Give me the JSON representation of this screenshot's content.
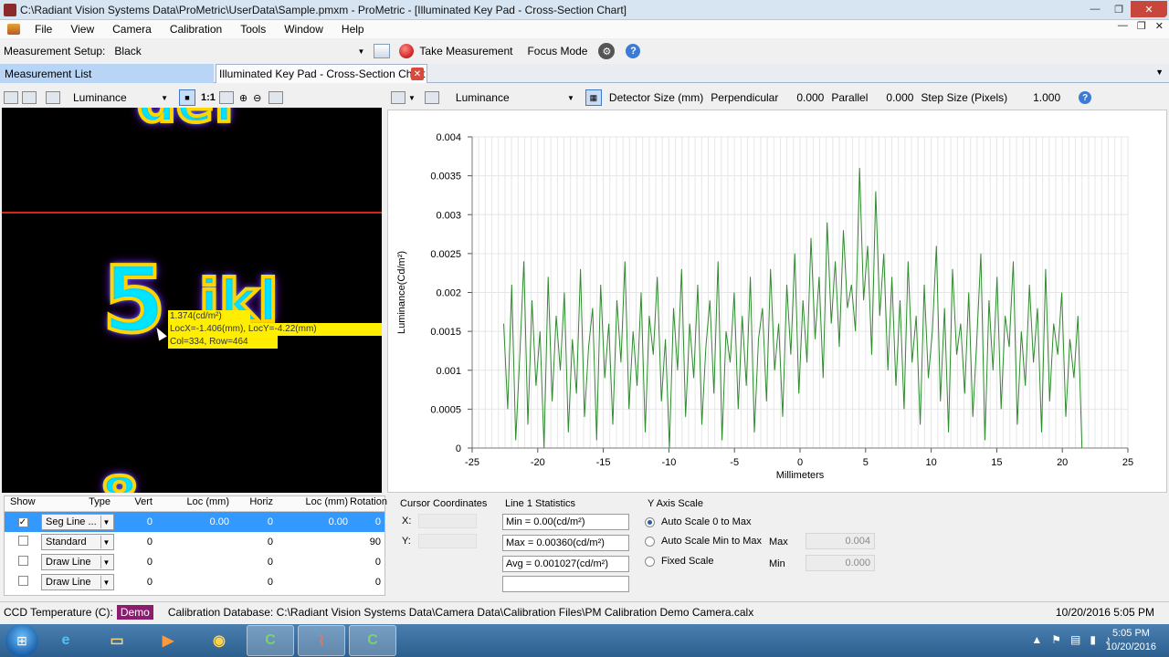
{
  "window": {
    "title": "C:\\Radiant Vision Systems Data\\ProMetric\\UserData\\Sample.pmxm - ProMetric - [Illuminated Key Pad - Cross-Section Chart]",
    "min": "—",
    "restore": "❐",
    "close": "✕"
  },
  "menu": {
    "items": [
      "File",
      "View",
      "Camera",
      "Calibration",
      "Tools",
      "Window",
      "Help"
    ]
  },
  "setup": {
    "label": "Measurement Setup:",
    "value": "Black",
    "take_measurement": "Take Measurement",
    "focus_mode": "Focus Mode",
    "help": "?"
  },
  "tabs": {
    "measurement_list": "Measurement List",
    "active": "Illuminated Key Pad - Cross-Section Chart",
    "close": "✕"
  },
  "image_toolbar": {
    "luminance": "Luminance",
    "one_to_one": "1:1"
  },
  "chart_toolbar": {
    "luminance": "Luminance",
    "detector_size": "Detector Size (mm)",
    "perpendicular": "Perpendicular",
    "perpendicular_value": "0.000",
    "parallel": "Parallel",
    "parallel_value": "0.000",
    "step_size": "Step Size (Pixels)",
    "step_size_value": "1.000"
  },
  "image": {
    "digit_five": "5",
    "letters": "jkl",
    "tooltip": {
      "line1": "1.374(cd/m²)",
      "line2": "LocX=-1.406(mm), LocY=-4.22(mm)",
      "line3": "Col=334, Row=464"
    }
  },
  "chart_data": {
    "type": "line",
    "xlabel": "Millimeters",
    "ylabel": "Luminance(Cd/m²)",
    "xlim": [
      -25,
      25
    ],
    "ylim": [
      0,
      0.004
    ],
    "xticks": [
      -25,
      -20,
      -15,
      -10,
      -5,
      0,
      5,
      10,
      15,
      20,
      25
    ],
    "yticks": [
      "0",
      "0.0005",
      "0.001",
      "0.0015",
      "0.002",
      "0.0025",
      "0.003",
      "0.0035",
      "0.004"
    ],
    "line_color": "#2e8b2e",
    "grid": true,
    "x_start": -22.6,
    "x_end": 21.5,
    "series": [
      {
        "values": [
          0.0016,
          0.0005,
          0.0021,
          0.0001,
          0.0012,
          0.0024,
          0.0003,
          0.0019,
          0.0008,
          0.0015,
          0.0,
          0.0022,
          0.0006,
          0.0017,
          0.001,
          0.002,
          0.0002,
          0.0014,
          0.0007,
          0.0023,
          0.0004,
          0.0013,
          0.0018,
          0.0001,
          0.0021,
          0.0009,
          0.0016,
          0.0003,
          0.0019,
          0.0011,
          0.0024,
          0.0005,
          0.0015,
          0.0008,
          0.002,
          0.0002,
          0.0017,
          0.0012,
          0.0022,
          0.0006,
          0.0014,
          0.0,
          0.0018,
          0.001,
          0.0023,
          0.0004,
          0.0016,
          0.0009,
          0.0021,
          0.0003,
          0.0013,
          0.0019,
          0.0007,
          0.0024,
          0.0001,
          0.0015,
          0.0011,
          0.002,
          0.0005,
          0.0017,
          0.0008,
          0.0022,
          0.0002,
          0.0014,
          0.0018,
          0.0006,
          0.0023,
          0.001,
          0.0016,
          0.0004,
          0.0021,
          0.0012,
          0.0025,
          0.0007,
          0.0019,
          0.0011,
          0.0027,
          0.0014,
          0.0022,
          0.0009,
          0.0029,
          0.0016,
          0.0024,
          0.0013,
          0.0028,
          0.0018,
          0.0021,
          0.0015,
          0.0036,
          0.0019,
          0.0026,
          0.0012,
          0.0033,
          0.0017,
          0.0025,
          0.001,
          0.0022,
          0.0008,
          0.0019,
          0.0005,
          0.0024,
          0.0011,
          0.0017,
          0.0003,
          0.0021,
          0.0009,
          0.0015,
          0.0026,
          0.0006,
          0.0018,
          0.0002,
          0.0023,
          0.0012,
          0.0016,
          0.0007,
          0.002,
          0.0004,
          0.0014,
          0.0025,
          0.0001,
          0.0019,
          0.001,
          0.0022,
          0.0005,
          0.0017,
          0.0013,
          0.0024,
          0.0003,
          0.0015,
          0.0008,
          0.0021,
          0.0011,
          0.0018,
          0.0002,
          0.0023,
          0.0006,
          0.0016,
          0.0012,
          0.002,
          0.0004,
          0.0014,
          0.0009,
          0.0017,
          0.0
        ]
      }
    ]
  },
  "grid": {
    "headers": [
      "Show",
      "Type",
      "Vert",
      "Loc (mm)",
      "Horiz",
      "Loc (mm)",
      "Rotation"
    ],
    "rows": [
      {
        "show": "✓",
        "type": "Seg Line ...",
        "vert": "0",
        "loc1": "0.00",
        "horiz": "0",
        "loc2": "0.00",
        "rot": "0"
      },
      {
        "show": "",
        "type": "Standard",
        "vert": "0",
        "loc1": "",
        "horiz": "0",
        "loc2": "",
        "rot": "90"
      },
      {
        "show": "",
        "type": "Draw Line",
        "vert": "0",
        "loc1": "",
        "horiz": "0",
        "loc2": "",
        "rot": "0"
      },
      {
        "show": "",
        "type": "Draw Line",
        "vert": "0",
        "loc1": "",
        "horiz": "0",
        "loc2": "",
        "rot": "0"
      }
    ]
  },
  "cursor_coords": {
    "title": "Cursor Coordinates",
    "x_label": "X:",
    "y_label": "Y:"
  },
  "line_stats": {
    "title": "Line 1 Statistics",
    "min": "Min = 0.00(cd/m²)",
    "max": "Max = 0.00360(cd/m²)",
    "avg": "Avg = 0.001027(cd/m²)"
  },
  "y_axis_scale": {
    "title": "Y Axis Scale",
    "auto_zero": "Auto Scale 0 to Max",
    "auto_minmax": "Auto Scale Min to Max",
    "fixed": "Fixed Scale",
    "max_label": "Max",
    "max_value": "0.004",
    "min_label": "Min",
    "min_value": "0.000"
  },
  "status": {
    "ccd_temp": "CCD Temperature (C):",
    "demo": "Demo",
    "calibration": "Calibration Database: C:\\Radiant Vision Systems Data\\Camera Data\\Calibration Files\\PM Calibration Demo Camera.calx",
    "datetime": "10/20/2016 5:05 PM"
  },
  "taskbar": {
    "time": "5:05 PM",
    "date": "10/20/2016"
  }
}
